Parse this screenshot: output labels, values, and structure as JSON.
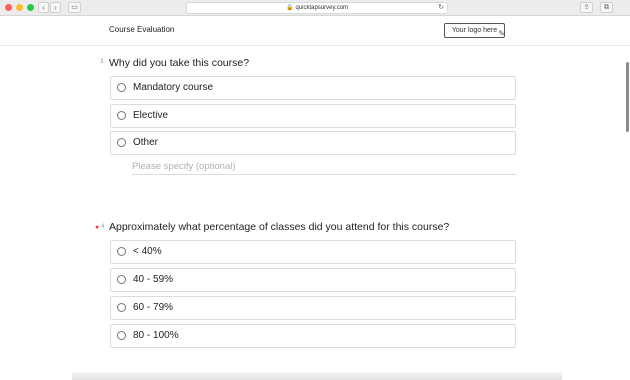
{
  "browser": {
    "url": "quicktapsurvey.com"
  },
  "header": {
    "title": "Course Evaluation",
    "logo_placeholder": "Your logo here"
  },
  "questions": [
    {
      "number": "3",
      "text": "Why did you take this course?",
      "options": [
        "Mandatory course",
        "Elective",
        "Other"
      ],
      "specify_placeholder": "Please specify (optional)"
    },
    {
      "number": "4",
      "text": "Approximately what percentage of classes did you attend for this course?",
      "options": [
        "< 40%",
        "40 - 59%",
        "60 - 79%",
        "80 - 100%"
      ]
    }
  ]
}
